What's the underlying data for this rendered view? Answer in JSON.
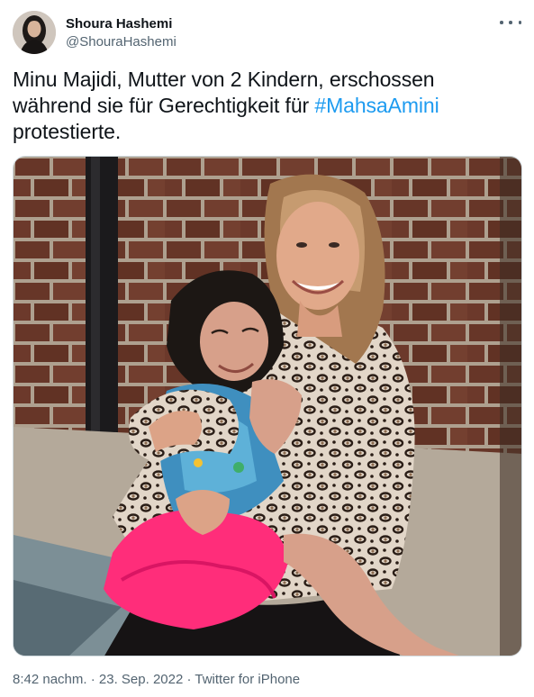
{
  "author": {
    "display_name": "Shoura Hashemi",
    "handle": "@ShouraHashemi"
  },
  "tweet": {
    "text_part1": "Minu Majidi, Mutter von 2 Kindern, erschossen während sie für Gerechtigkeit für ",
    "hashtag": "#MahsaAmini",
    "text_part2": " protestierte."
  },
  "meta": {
    "time": "8:42 nachm.",
    "separator": " · ",
    "date": "23. Sep. 2022",
    "source": "Twitter for iPhone"
  },
  "icons": {
    "more": "more-options-icon"
  },
  "colors": {
    "link": "#1d9bf0",
    "secondary_text": "#536471",
    "border": "#cfd9de"
  }
}
